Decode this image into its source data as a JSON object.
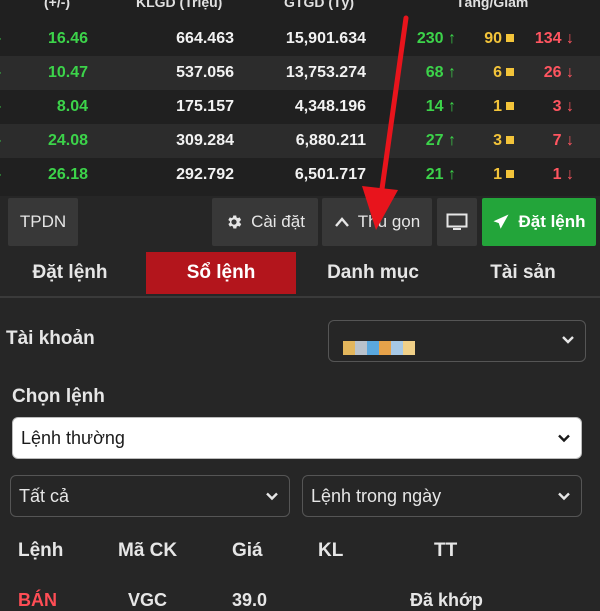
{
  "market_table": {
    "columns": [
      "(+/-)",
      "KLGD (Triệu)",
      "GTGD (Tỷ)",
      "Tăng/Giảm"
    ],
    "rows": [
      {
        "change": "16.46",
        "klgd": "664.463",
        "gtgd": "15,901.634",
        "up": "230",
        "ref": "90",
        "down": "134"
      },
      {
        "change": "10.47",
        "klgd": "537.056",
        "gtgd": "13,753.274",
        "up": "68",
        "ref": "6",
        "down": "26"
      },
      {
        "change": "8.04",
        "klgd": "175.157",
        "gtgd": "4,348.196",
        "up": "14",
        "ref": "1",
        "down": "3"
      },
      {
        "change": "24.08",
        "klgd": "309.284",
        "gtgd": "6,880.211",
        "up": "27",
        "ref": "3",
        "down": "7"
      },
      {
        "change": "26.18",
        "klgd": "292.792",
        "gtgd": "6,501.717",
        "up": "21",
        "ref": "1",
        "down": "1"
      }
    ]
  },
  "toolbar": {
    "tpdn": "TPDN",
    "settings": "Cài đặt",
    "collapse": "Thu gọn",
    "place_order": "Đặt lệnh"
  },
  "tabs": [
    "Đặt lệnh",
    "Sổ lệnh",
    "Danh mục",
    "Tài sản"
  ],
  "form": {
    "account_label": "Tài khoản",
    "order_type_label": "Chọn lệnh",
    "order_type_value": "Lệnh thường",
    "filter_all": "Tất cả",
    "filter_period": "Lệnh trong ngày"
  },
  "orders": {
    "columns": [
      "Lệnh",
      "Mã CK",
      "Giá",
      "KL",
      "TT"
    ],
    "first_row": {
      "side": "BÁN",
      "symbol": "VGC",
      "price": "39.0",
      "status": "Đã khớp"
    }
  },
  "colors": {
    "up": "#3cd34a",
    "down": "#ff5560",
    "ref": "#f3c43a",
    "active_tab": "#b3151c",
    "order_button": "#23a53a",
    "annotation_arrow": "#e8141c"
  }
}
